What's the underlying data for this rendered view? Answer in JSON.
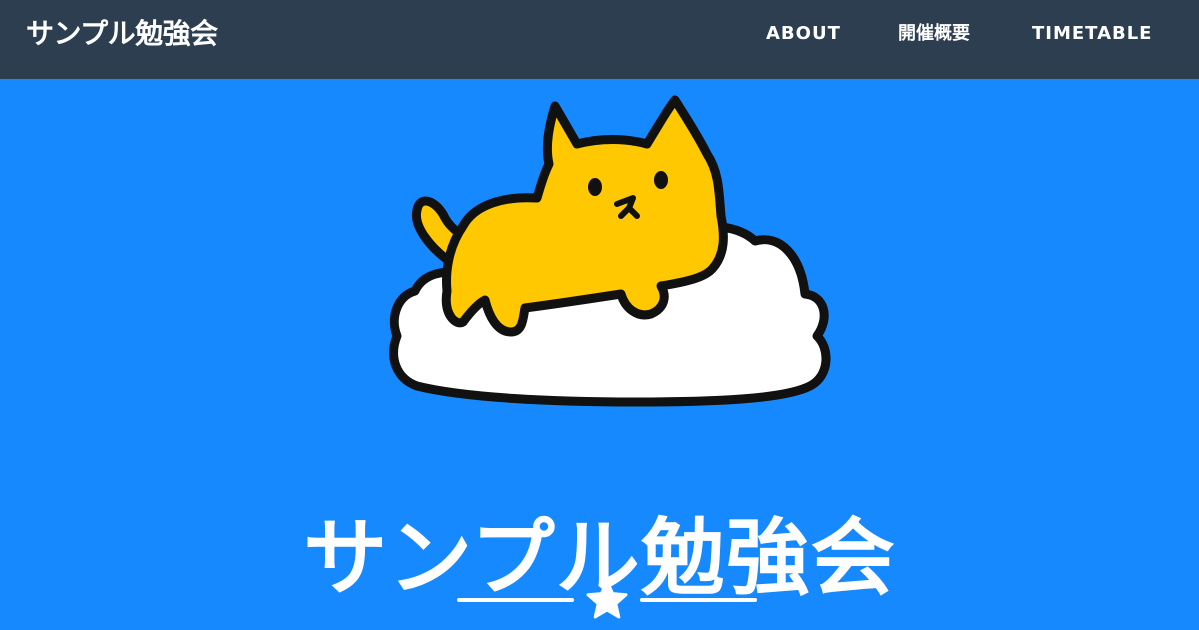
{
  "navbar": {
    "brand": "サンプル勉強会",
    "items": [
      {
        "label": "ABOUT"
      },
      {
        "label": "開催概要"
      },
      {
        "label": "TIMETABLE"
      }
    ]
  },
  "hero": {
    "title": "サンプル勉強会",
    "image_icon": "cat-on-cloud-icon",
    "divider_icon": "star-icon"
  },
  "colors": {
    "navbar_bg": "#2c3e50",
    "hero_bg": "#1689ff",
    "text": "#ffffff",
    "cat": "#ffc800",
    "outline": "#111111"
  }
}
